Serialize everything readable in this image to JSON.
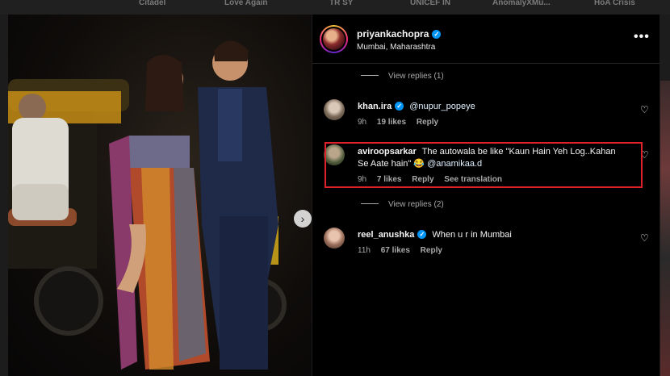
{
  "top_bar": {
    "items": [
      "Citadel",
      "Love Again",
      "TR SY",
      "UNICEF IN",
      "AnomalyXMu...",
      "HoA Crisis"
    ]
  },
  "post": {
    "next_button_icon": "chevron-right-icon",
    "username": "priyankachopra",
    "location": "Mumbai, Maharashtra",
    "verified": true
  },
  "comments": {
    "view_replies_1": "View replies (1)",
    "view_replies_2": "View replies (2)",
    "items": [
      {
        "username": "khan.ira",
        "verified": true,
        "text": "@nupur_popeye",
        "time": "9h",
        "likes": "19 likes",
        "reply": "Reply"
      },
      {
        "username": "aviroopsarkar",
        "verified": false,
        "text": "The autowala be like \"Kaun Hain Yeh Log..Kahan Se Aate hain\" 😂",
        "mention": "@anamikaa.d",
        "time": "9h",
        "likes": "7 likes",
        "reply": "Reply",
        "translate": "See translation",
        "highlighted": true
      },
      {
        "username": "reel_anushka",
        "verified": true,
        "text": "When u r in Mumbai",
        "time": "11h",
        "likes": "67 likes",
        "reply": "Reply"
      }
    ]
  },
  "colors": {
    "highlight_border": "#e0202a",
    "verified_badge": "#0095f6",
    "panel_background": "#000000"
  }
}
